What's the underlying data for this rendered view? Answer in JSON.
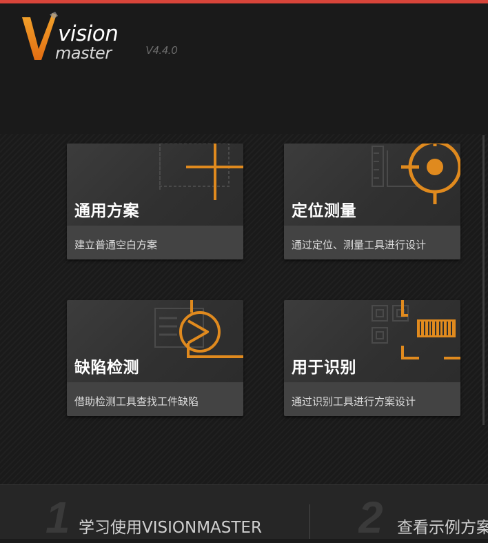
{
  "app": {
    "logo_text_top": "vision",
    "logo_text_bottom": "master",
    "version": "V4.4.0"
  },
  "cards": [
    {
      "title": "通用方案",
      "description": "建立普通空白方案",
      "icon": "plus-crosshair-icon"
    },
    {
      "title": "定位测量",
      "description": "通过定位、测量工具进行设计",
      "icon": "target-icon"
    },
    {
      "title": "缺陷检测",
      "description": "借助检测工具查找工件缺陷",
      "icon": "defect-inspect-icon"
    },
    {
      "title": "用于识别",
      "description": "通过识别工具进行方案设计",
      "icon": "barcode-scan-icon"
    }
  ],
  "bottom": {
    "steps": [
      {
        "number": "1",
        "label": "学习使用VISIONMASTER"
      },
      {
        "number": "2",
        "label": "查看示例方案"
      }
    ]
  },
  "colors": {
    "accent": "#e08a1e",
    "top_bar": "#d8453a",
    "background": "#1b1b1b"
  }
}
